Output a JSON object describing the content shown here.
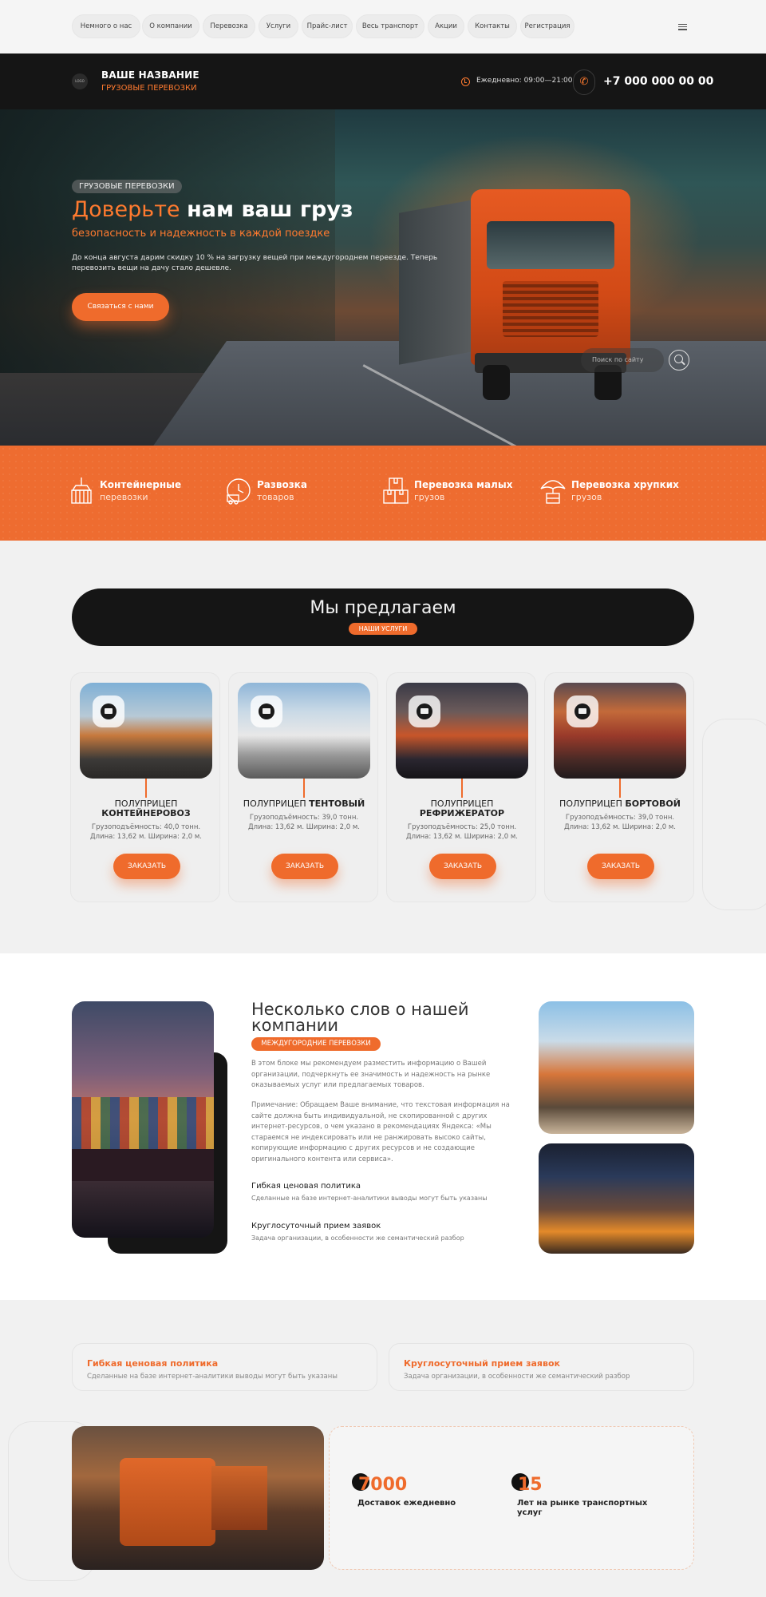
{
  "nav": {
    "items": [
      "Немного о нас",
      "О компании",
      "Перевозка",
      "Услуги",
      "Прайс-лист",
      "Весь транспорт",
      "Акции",
      "Контакты",
      "Регистрация"
    ]
  },
  "header": {
    "logo_text": "LOGO",
    "brand_name": "ВАШЕ НАЗВАНИЕ",
    "brand_sub": "ГРУЗОВЫЕ ПЕРЕВОЗКИ",
    "hours": "Ежедневно: 09:00—21:00",
    "phone": "+7 000 000 00 00"
  },
  "hero": {
    "tag": "ГРУЗОВЫЕ ПЕРЕВОЗКИ",
    "title_part1": "Доверьте ",
    "title_part2": "нам ваш груз",
    "subtitle": "безопасность и надежность в каждой поездке",
    "description": "До конца августа дарим скидку 10 % на загрузку вещей при междугороднем переезде. Теперь перевозить вещи на дачу стало дешевле.",
    "cta": "Связаться с нами",
    "search_placeholder": "Поиск по сайту"
  },
  "features": [
    {
      "title": "Контейнерные",
      "sub": "перевозки",
      "icon": "container-crane-icon"
    },
    {
      "title": "Развозка",
      "sub": "товаров",
      "icon": "delivery-clock-icon"
    },
    {
      "title": "Перевозка малых",
      "sub": "грузов",
      "icon": "boxes-icon"
    },
    {
      "title": "Перевозка хрупких",
      "sub": "грузов",
      "icon": "umbrella-box-icon"
    }
  ],
  "offer": {
    "title": "Мы предлагаем",
    "badge": "НАШИ УСЛУГИ"
  },
  "cards": [
    {
      "light": "ПОЛУПРИЦЕП",
      "bold": "КОНТЕЙНЕРОВОЗ",
      "spec1": "Грузоподъёмность: 40,0 тонн.",
      "spec2": "Длина: 13,62 м. Ширина: 2,0 м.",
      "button": "ЗАКАЗАТЬ",
      "icon": "container-icon"
    },
    {
      "light": "ПОЛУПРИЦЕП",
      "bold": "ТЕНТОВЫЙ",
      "spec1": "Грузоподъёмность: 39,0 тонн.",
      "spec2": "Длина: 13,62 м. Ширина: 2,0 м.",
      "button": "ЗАКАЗАТЬ",
      "icon": "van-icon"
    },
    {
      "light": "ПОЛУПРИЦЕП",
      "bold": "РЕФРИЖЕРАТОР",
      "spec1": "Грузоподъёмность: 25,0 тонн.",
      "spec2": "Длина: 13,62 м. Ширина: 2,0 м.",
      "button": "ЗАКАЗАТЬ",
      "icon": "truck-icon"
    },
    {
      "light": "ПОЛУПРИЦЕП",
      "bold": "БОРТОВОЙ",
      "spec1": "Грузоподъёмность: 39,0 тонн.",
      "spec2": "Длина: 13,62 м. Ширина: 2,0 м.",
      "button": "ЗАКАЗАТЬ",
      "icon": "cargo-icon"
    }
  ],
  "about": {
    "title": "Несколько слов о нашей компании",
    "badge": "МЕЖДУГОРОДНИЕ ПЕРЕВОЗКИ",
    "p1": "В этом блоке мы рекомендуем разместить информацию о Вашей организации, подчеркнуть ее значимость и надежность на рынке оказываемых услуг или предлагаемых товаров.",
    "p2": "Примечание: Обращаем Ваше внимание, что текстовая информация на сайте должна быть индивидуальной, не скопированной с других интернет-ресурсов, о чем указано в рекомендациях Яндекса: «Мы стараемся не индексировать или не ранжировать высоко сайты, копирующие информацию с других ресурсов и не создающие оригинального контента или сервиса».",
    "h1": "Гибкая ценовая политика",
    "s1": "Сделанные на базе интернет-аналитики выводы могут быть указаны",
    "h2": "Круглосуточный прием заявок",
    "s2": "Задача организации, в особенности же семантический разбор"
  },
  "info": [
    {
      "title": "Гибкая ценовая политика",
      "text": "Сделанные на базе интернет-аналитики выводы могут быть указаны"
    },
    {
      "title": "Круглосуточный прием заявок",
      "text": "Задача организации, в особенности же семантический разбор"
    }
  ],
  "stats": [
    {
      "number": "7000",
      "label": "Доставок ежедневно"
    },
    {
      "number": "15",
      "label": "Лет на рынке транспортных услуг"
    }
  ],
  "colors": {
    "accent": "#ef6b2c",
    "dark": "#151515",
    "light_bg": "#f1f1f1"
  }
}
